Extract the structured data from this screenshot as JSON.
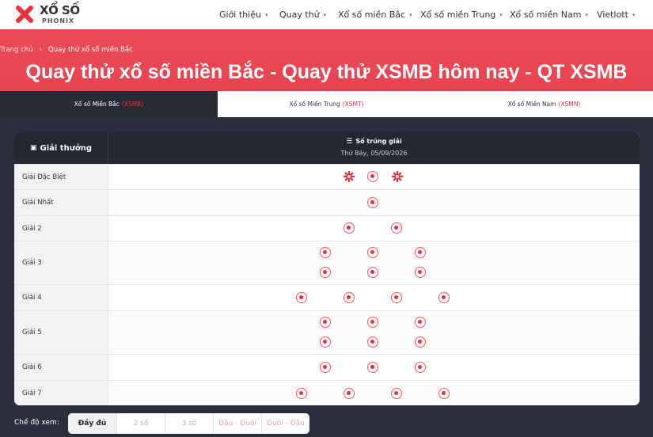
{
  "header": {
    "logo_title": "XỔ SỐ",
    "logo_sub": "PHONIX",
    "nav": [
      {
        "label": "Giới thiệu",
        "has_caret": true
      },
      {
        "label": "Quay thử",
        "has_caret": true
      },
      {
        "label": "Xổ số miền Bắc",
        "has_caret": true
      },
      {
        "label": "Xổ số miền Trung",
        "has_caret": true
      },
      {
        "label": "Xổ số miền Nam",
        "has_caret": true
      },
      {
        "label": "Vietlott",
        "has_caret": true
      }
    ]
  },
  "breadcrumb": {
    "home": "Trang chủ",
    "separator": "›",
    "current": "Quay thử xổ số miền Bắc"
  },
  "page_title": "Quay thử xổ số miền Bắc - Quay thử XSMB hôm nay - QT XSMB",
  "tabs": [
    {
      "label": "Xổ số Miền Bắc",
      "code": "(XSMB)",
      "active": true
    },
    {
      "label": "Xổ số Miền Trung",
      "code": "(XSMT)",
      "active": false
    },
    {
      "label": "Xổ số Miền Nam",
      "code": "(XSMN)",
      "active": false
    }
  ],
  "table": {
    "prize_header": "Giải thưởng",
    "numbers_header": "Số trúng giải",
    "date": "Thứ Bảy, 05/09/2026",
    "rows": [
      {
        "label": "Giải Đặc Biệt",
        "lines": 1,
        "per_line": 3,
        "special": true
      },
      {
        "label": "Giải Nhất",
        "lines": 1,
        "per_line": 1
      },
      {
        "label": "Giải 2",
        "lines": 1,
        "per_line": 2
      },
      {
        "label": "Giải 3",
        "lines": 2,
        "per_line": 3
      },
      {
        "label": "Giải 4",
        "lines": 1,
        "per_line": 4
      },
      {
        "label": "Giải 5",
        "lines": 2,
        "per_line": 3
      },
      {
        "label": "Giải 6",
        "lines": 1,
        "per_line": 3
      },
      {
        "label": "Giải 7",
        "lines": 1,
        "per_line": 4
      }
    ]
  },
  "view_mode": {
    "label": "Chế độ xem:",
    "options": [
      "Đầy đủ",
      "2 số",
      "3 số",
      "Đầu - Đuôi",
      "Đuôi - Đầu"
    ],
    "selected": "Đầy đủ"
  },
  "colors": {
    "brand_red": "#e8323d",
    "hero": "#ea4a55",
    "dark": "#262b36"
  }
}
